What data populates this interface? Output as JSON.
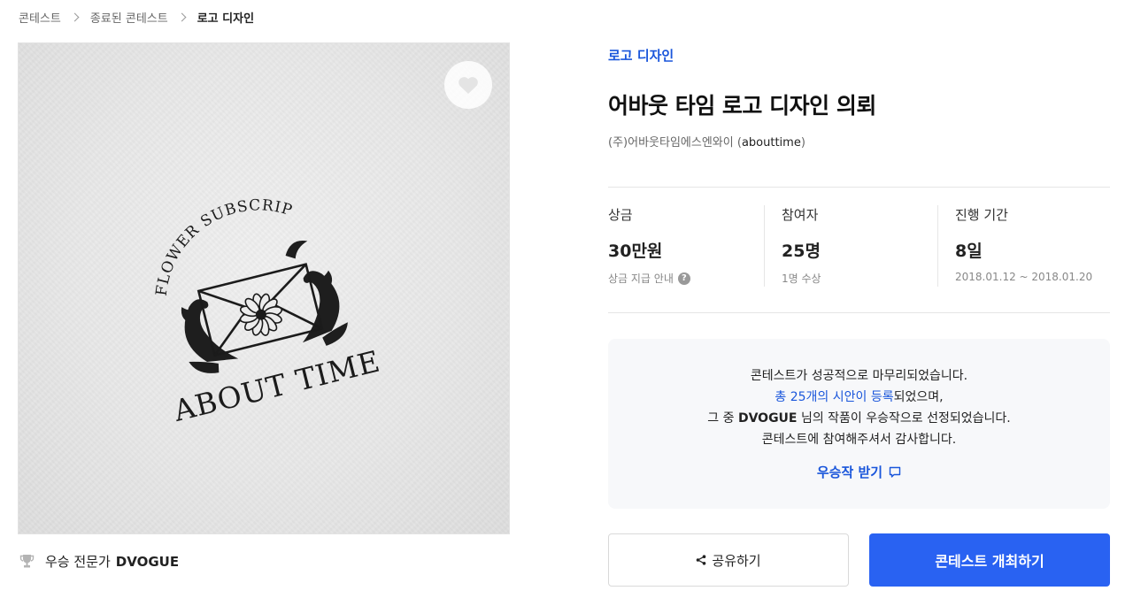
{
  "breadcrumb": {
    "items": [
      "콘테스트",
      "종료된 콘테스트",
      "로고 디자인"
    ]
  },
  "hero": {
    "logo_text": {
      "arc_text": "FLOWER SUBSCRIPTION",
      "main_text": "ABOUT TIME"
    }
  },
  "winner": {
    "label": "우승 전문가",
    "name": "DVOGUE"
  },
  "contest": {
    "category": "로고 디자인",
    "title": "어바웃 타임 로고 디자인 의뢰",
    "host_company": "(주)어바웃타임에스엔와이",
    "host_handle_open": " (",
    "host_handle": "abouttime",
    "host_handle_close": ")"
  },
  "stats": {
    "prize": {
      "label": "상금",
      "value": "30만원",
      "sub": "상금 지급 안내",
      "help_glyph": "?"
    },
    "participants": {
      "label": "참여자",
      "value": "25명",
      "sub": "1명 수상"
    },
    "period": {
      "label": "진행 기간",
      "value": "8일",
      "sub": "2018.01.12 ~ 2018.01.20"
    }
  },
  "notice": {
    "line1": "콘테스트가 성공적으로 마무리되었습니다.",
    "line2_highlight": "총 25개의 시안이 등록",
    "line2_rest": "되었으며,",
    "line3_prefix": "그 중 ",
    "line3_name": "DVOGUE",
    "line3_suffix": " 님의 작품이 우승작으로 선정되었습니다.",
    "line4": "콘테스트에 참여해주셔서 감사합니다.",
    "receive_label": "우승작 받기"
  },
  "actions": {
    "share_label": "공유하기",
    "host_label": "콘테스트 개최하기"
  },
  "colors": {
    "accent": "#1a56db",
    "primary_button": "#2962f2"
  },
  "icons": [
    "chevron-right-icon",
    "heart-icon",
    "trophy-icon",
    "help-icon",
    "chat-icon",
    "share-icon"
  ]
}
